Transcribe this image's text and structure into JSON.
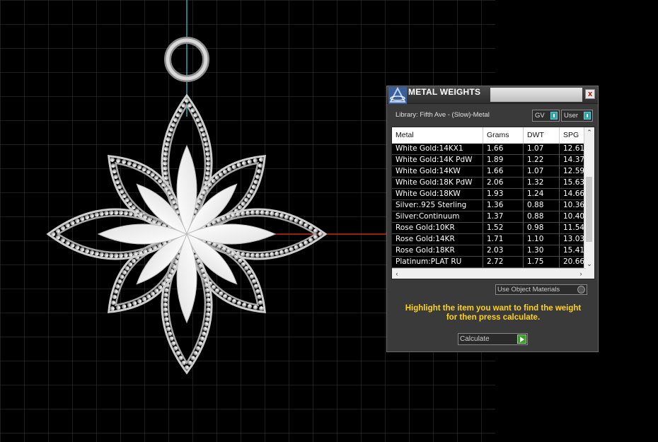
{
  "panel": {
    "title": "METAL WEIGHTS",
    "close_label": "x",
    "library_label": "Library: Fifth Ave - (Slow)-Metal",
    "toggles": [
      {
        "label": "GV"
      },
      {
        "label": "User"
      }
    ],
    "table": {
      "columns": [
        "Metal",
        "Grams",
        "DWT",
        "SPG"
      ],
      "rows": [
        [
          "White Gold:14KX1",
          "1.66",
          "1.07",
          "12.61"
        ],
        [
          "White Gold:14K PdW",
          "1.89",
          "1.22",
          "14.37"
        ],
        [
          "White Gold:14KW",
          "1.66",
          "1.07",
          "12.59"
        ],
        [
          "White Gold:18K PdW",
          "2.06",
          "1.32",
          "15.63"
        ],
        [
          "White Gold:18KW",
          "1.93",
          "1.24",
          "14.66"
        ],
        [
          "Silver:.925 Sterling",
          "1.36",
          "0.88",
          "10.36"
        ],
        [
          "Silver:Continuum",
          "1.37",
          "0.88",
          "10.40"
        ],
        [
          "Rose Gold:10KR",
          "1.52",
          "0.98",
          "11.54"
        ],
        [
          "Rose Gold:14KR",
          "1.71",
          "1.10",
          "13.03"
        ],
        [
          "Rose Gold:18KR",
          "2.03",
          "1.30",
          "15.41"
        ],
        [
          "Platinum:PLAT RU",
          "2.72",
          "1.75",
          "20.66"
        ]
      ]
    },
    "use_object_materials_label": "Use Object Materials",
    "instruction_line1": "Highlight the item you want to find the weight",
    "instruction_line2": "for then press calculate.",
    "calculate_label": "Calculate"
  },
  "colors": {
    "background": "#000000",
    "grid": "#2c2c2c",
    "axis_x": "#c0301a",
    "axis_y": "#2aa7b0",
    "instruction": "#ffd21e",
    "toggle_accent": "#2fa3a7",
    "calculate_accent": "#3c9a2b"
  }
}
